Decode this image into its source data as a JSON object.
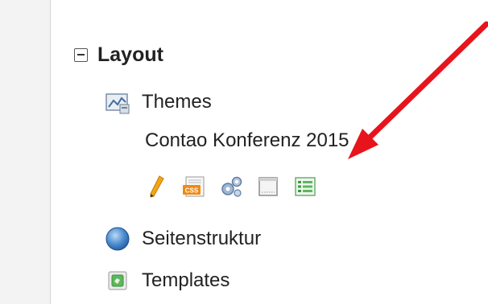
{
  "sidebar": {
    "section": {
      "title": "Layout",
      "toggle_icon": "collapse-minus-icon"
    },
    "items": [
      {
        "label": "Themes",
        "icon": "themes-icon"
      },
      {
        "label": "Seitenstruktur",
        "icon": "globe-icon"
      },
      {
        "label": "Templates",
        "icon": "templates-icon"
      }
    ],
    "theme": {
      "name": "Contao Konferenz 2015",
      "actions": [
        {
          "icon": "edit-pencil-icon"
        },
        {
          "icon": "css-stylesheets-icon"
        },
        {
          "icon": "modules-gear-icon"
        },
        {
          "icon": "page-layouts-icon"
        },
        {
          "icon": "image-sizes-list-icon"
        }
      ]
    }
  },
  "annotation": {
    "arrow_color": "#e8141c"
  }
}
